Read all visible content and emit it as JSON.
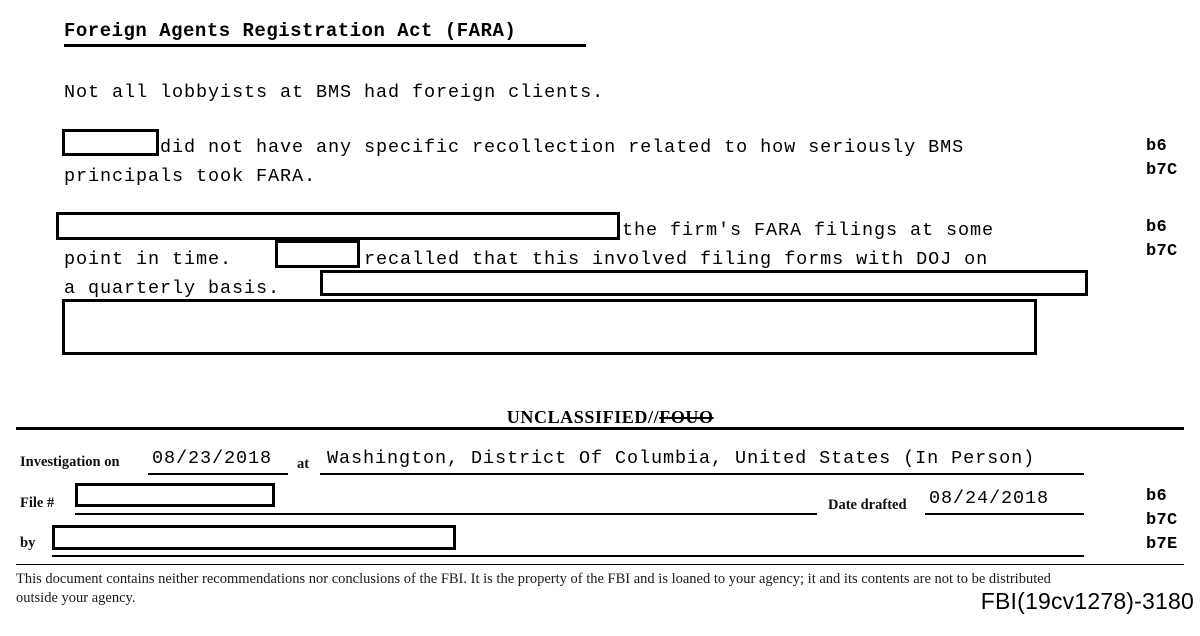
{
  "document": {
    "heading": "Foreign Agents Registration Act (FARA)",
    "paragraphs": {
      "intro": "Not all lobbyists at BMS had foreign clients.",
      "p1_line1_after_redaction": "did not have any specific recollection related to how seriously BMS",
      "p1_line2": "principals took FARA.",
      "p2_line1_after_redaction": "the firm's FARA filings at some",
      "p2_line2_before_redaction": "point in time.",
      "p2_line2_after_redaction": "recalled that this involved filing forms with DOJ on",
      "p2_line3_before_redaction": "a quarterly basis."
    },
    "exemption_codes": {
      "group1": [
        "b6",
        "b7C"
      ],
      "group2": [
        "b6",
        "b7C"
      ],
      "group3": [
        "b6",
        "b7C",
        "b7E"
      ]
    },
    "classification": {
      "prefix": "UNCLASSIFIED//",
      "struck": "FOUO"
    },
    "footer_form": {
      "investigation_on_label": "Investigation on",
      "investigation_on_value": "08/23/2018",
      "at_label": "at",
      "location_value": "Washington, District Of Columbia, United States (In Person)",
      "file_number_label": "File #",
      "file_number_value": "",
      "date_drafted_label": "Date drafted",
      "date_drafted_value": "08/24/2018",
      "by_label": "by",
      "by_value": ""
    },
    "disclaimer": "This document contains neither recommendations nor conclusions of the FBI. It is the property of the FBI and is loaned to your agency; it and its contents are not to be distributed outside your agency.",
    "bates_number": "FBI(19cv1278)-3180"
  }
}
